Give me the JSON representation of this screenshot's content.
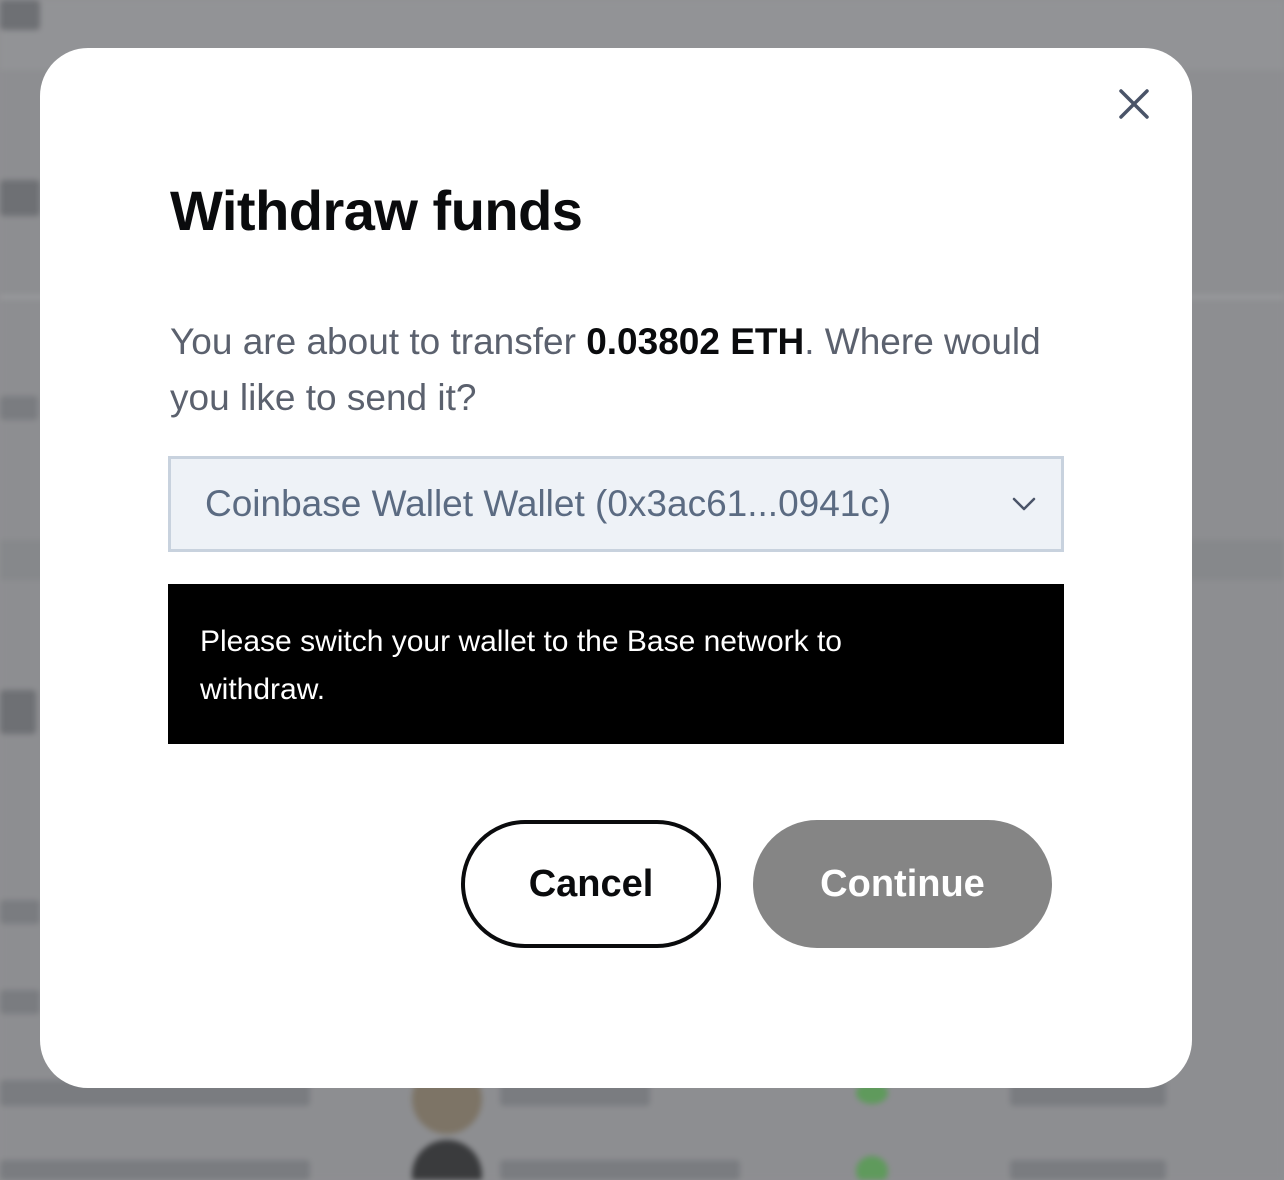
{
  "modal": {
    "title": "Withdraw funds",
    "description_prefix": "You are about to transfer ",
    "amount": "0.03802 ETH",
    "description_suffix": ". Where would you like to send it?",
    "wallet_select": {
      "selected": "Coinbase Wallet Wallet (0x3ac61...0941c)"
    },
    "alert": {
      "message": "Please switch your wallet to the Base network to withdraw."
    },
    "cancel_label": "Cancel",
    "continue_label": "Continue",
    "close_icon": "close-icon",
    "chevron_icon": "chevron-down-icon"
  },
  "colors": {
    "backdrop": "#8f9093",
    "modal_bg": "#ffffff",
    "title": "#0a0b0d",
    "body_text": "#5b616e",
    "select_bg": "#eef2f7",
    "select_border": "#c8d2de",
    "alert_bg": "#000000",
    "continue_disabled_bg": "#858585"
  }
}
